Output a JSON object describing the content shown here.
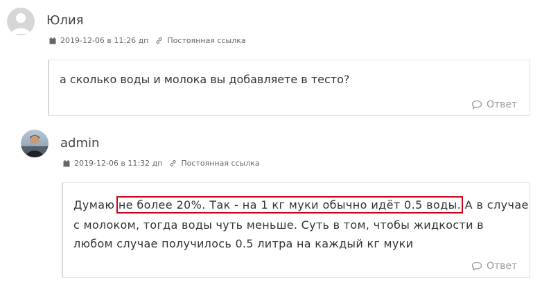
{
  "comments": [
    {
      "author": "Юлия",
      "date": "2019-12-06 в 11:26 дп",
      "permalink": "Постоянная ссылка",
      "text": "а сколько воды и молока вы добавляете в тесто?",
      "reply": "Ответ"
    },
    {
      "author": "admin",
      "date": "2019-12-06 в 11:32 дп",
      "permalink": "Постоянная ссылка",
      "text_line1_before": "Думаю ",
      "text_line1_highlight": "не более 20%. Так - на 1 кг муки обычно идёт 0.5 воды.",
      "text_line1_after": " А в случае",
      "text_line2": "с молоком, тогда воды чуть меньше. Суть в том, чтобы жидкости в",
      "text_line3": "любом случае получилось 0.5 литра на каждый кг муки",
      "reply": "Ответ"
    }
  ],
  "icons": {
    "calendar": "calendar-icon",
    "link": "link-icon",
    "comment": "speech-bubble-icon"
  },
  "colors": {
    "highlight_border": "#d0021b",
    "reply_text": "#9a9a9a"
  }
}
